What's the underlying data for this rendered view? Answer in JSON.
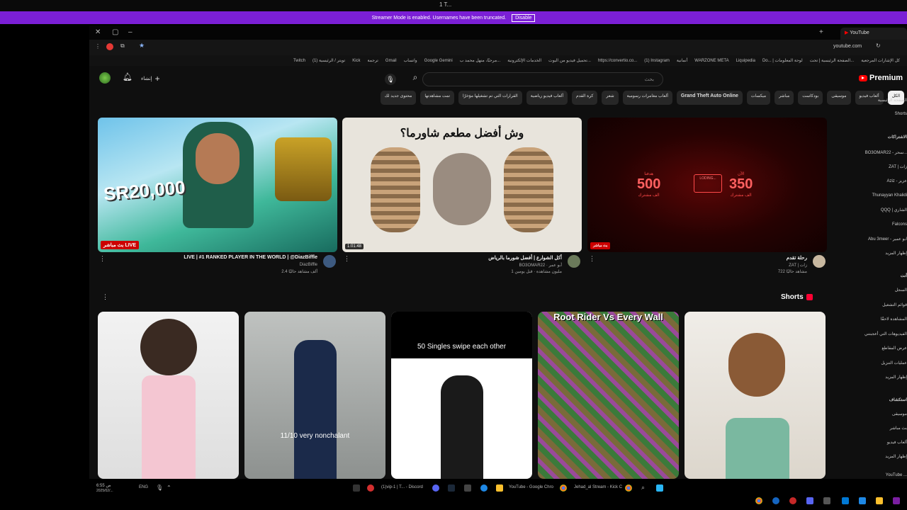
{
  "topstrip": {
    "title": "1 T..."
  },
  "streamer_banner": {
    "message": "Streamer Mode is enabled. Usernames have been truncated.",
    "button": "Disable"
  },
  "browser": {
    "tab_title": "YouTube",
    "url": "youtube.com",
    "bookmarks": [
      "كل الإشارات المرجعية",
      "الصفحة الرئيسية | تحت...",
      "Do... | لوحة المعلومات",
      "Liquipedia",
      "WARZONE META",
      "أنمانية",
      "(1) Instagram",
      "https://convertio.co...",
      "تحميل فيديو من اليوت...",
      "الخدمات الإلكترونية",
      "مرحبًا، منهل محمد ب...",
      "Google Gemini",
      "واتساب",
      "Gmail",
      "ترجمة",
      "Kick",
      "(1) تويتر / الرئيسية",
      "Twitch"
    ]
  },
  "youtube": {
    "logo": "Premium",
    "search_placeholder": "بحث",
    "search_value": "",
    "create_label": "إنشاء",
    "chips": [
      "الكل",
      "ألعاب فيديو",
      "موسيقى",
      "بودكاست",
      "مباشر",
      "ميكسات",
      "Grand Theft Auto Online",
      "ألعاب مغامرات رسومية",
      "شعر",
      "كرة القدم",
      "ألعاب فيديو رياضية",
      "القرارات التي تم تشغيلها مؤخرًا",
      "تمت مشاهدتها",
      "محتوى جديد لك"
    ]
  },
  "sidebar": {
    "items": [
      "الصفحة الرئيسية",
      "Shorts",
      "الاشتراكات",
      "BO3OMAR22 - سحر...",
      "ZAT | زات",
      "Aziz - عزيز",
      "Thunayyan Khalidi",
      "QQQ | الشاري",
      "Falcons",
      "Abu 3meer - ابو عمير",
      "إظهار المزيد",
      "أنت",
      "السجل",
      "قوائم التشغيل",
      "المشاهدة لاحقًا",
      "الفيديوهات التي أعجبتني",
      "عرض المقاطع",
      "عمليات التنزيل",
      "إظهار المزيد",
      "استكشاف",
      "موسيقى",
      "بث مباشر",
      "ألعاب فيديو",
      "إظهار المزيد",
      "YouTube ..."
    ]
  },
  "videos": [
    {
      "title": "LIVE | #1 RANKED PLAYER IN THE WORLD | @DiazBiffle",
      "channel": "DiazBiffle",
      "stats": "2.4 ألف مشاهد حاليًا",
      "badge": "بث مباشر LIVE",
      "thumb_text": "SR20,000"
    },
    {
      "title": "أكل الشوارع | أفضل شورما بالرياض",
      "channel": "BO3OMAR22 · أبو عمر",
      "stats": "1 مليون مشاهدة · قبل يومين",
      "duration": "1:01:48",
      "thumb_text": "وش أفضل مطعم شاورما؟"
    },
    {
      "title": "رحلة تقدم",
      "channel": "ZAT | زات",
      "stats": "722 مشاهد حاليًا",
      "duration": "بث مباشر",
      "thumb_left": "500",
      "thumb_left_top": "هدفنا",
      "thumb_left_bottom": "الف مشترك",
      "thumb_mid": "LODING...",
      "thumb_right": "350",
      "thumb_right_top": "الآن",
      "thumb_right_bottom": "الف مشترك"
    }
  ],
  "shorts": {
    "header": "Shorts",
    "items": [
      {
        "caption": ""
      },
      {
        "caption": "11/10 very nonchalant"
      },
      {
        "caption": "50 Singles swipe each other"
      },
      {
        "caption": "Root Rider Vs Every Wall"
      },
      {
        "caption": ""
      }
    ]
  },
  "taskbar": {
    "time": "6:55 ص",
    "date": "2025/02/...",
    "lang": "ENG",
    "apps": [
      "(1)vip-1 | T... - Discord",
      "YouTube - Google Chro",
      "Jehad_al Stream - Kick C"
    ]
  },
  "colors": {
    "streamer": "#7b1fd6",
    "yt_red": "#ff0000",
    "bg": "#0f0f0f"
  }
}
